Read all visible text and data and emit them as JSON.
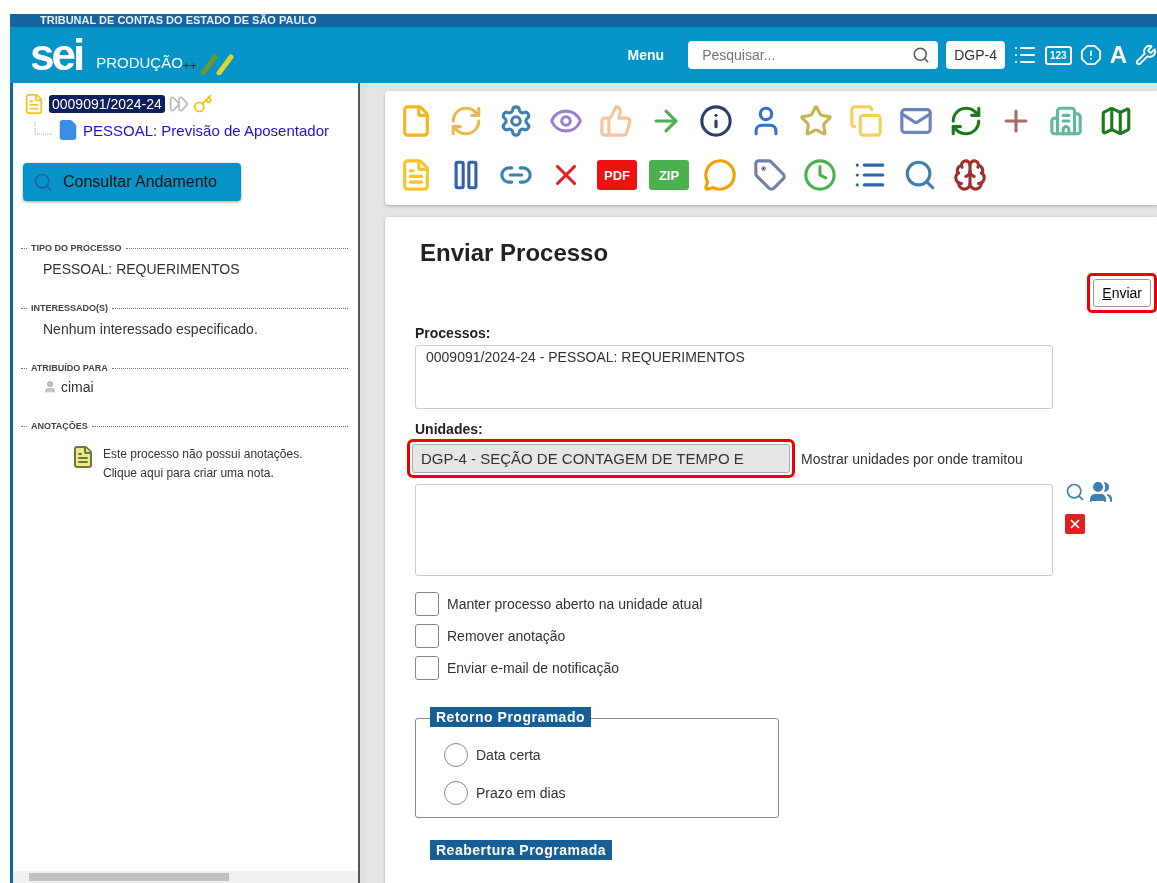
{
  "header": {
    "org": "TRIBUNAL DE CONTAS DO ESTADO DE SÃO PAULO",
    "logo": "sei",
    "env": "PRODUÇÃO",
    "env_suffix": "++",
    "menu": "Menu",
    "search": {
      "placeholder": "Pesquisar..."
    },
    "unit": "DGP-4",
    "icon_texts": [
      "123",
      "A"
    ]
  },
  "sidebar": {
    "process": {
      "number": "0009091/2024-24",
      "selected": true,
      "children": [
        {
          "label": "PESSOAL: Previsão de Aposentador",
          "selected": false
        }
      ]
    },
    "consult_button": "Consultar Andamento",
    "sections": [
      {
        "title": "TIPO DO PROCESSO",
        "kind": "text",
        "value": "PESSOAL: REQUERIMENTOS"
      },
      {
        "title": "INTERESSADO(S)",
        "kind": "text",
        "value": "Nenhum interessado especificado."
      },
      {
        "title": "ATRIBUÍDO PARA",
        "kind": "user",
        "value": "cimai"
      },
      {
        "title": "ANOTAÇÕES",
        "kind": "note",
        "value": "Este processo não possui anotações. Clique aqui para criar uma nota."
      }
    ]
  },
  "toolbar": {
    "rows": [
      [
        {
          "kind": "icon"
        },
        {
          "kind": "icon"
        },
        {
          "kind": "icon"
        },
        {
          "kind": "icon"
        },
        {
          "kind": "icon"
        },
        {
          "kind": "icon"
        },
        {
          "kind": "icon"
        },
        {
          "kind": "icon"
        },
        {
          "kind": "icon"
        },
        {
          "kind": "icon"
        },
        {
          "kind": "icon"
        },
        {
          "kind": "icon"
        },
        {
          "kind": "icon"
        },
        {
          "kind": "icon"
        },
        {
          "kind": "icon"
        }
      ],
      [
        {
          "kind": "icon"
        },
        {
          "kind": "icon"
        },
        {
          "kind": "icon"
        },
        {
          "kind": "icon"
        },
        {
          "kind": "badge",
          "text": "PDF",
          "color": "#ee1111"
        },
        {
          "kind": "badge",
          "text": "ZIP",
          "color": "#4caf50"
        },
        {
          "kind": "icon"
        },
        {
          "kind": "icon"
        },
        {
          "kind": "icon"
        },
        {
          "kind": "icon"
        },
        {
          "kind": "icon"
        },
        {
          "kind": "icon"
        }
      ]
    ]
  },
  "form": {
    "title": "Enviar Processo",
    "submit": {
      "label": "Enviar",
      "highlighted": true
    },
    "processes": {
      "label": "Processos:",
      "value": "0009091/2024-24 - PESSOAL: REQUERIMENTOS"
    },
    "units": {
      "label": "Unidades:",
      "value": "DGP-4 - SEÇÃO DE CONTAGEM DE TEMPO E",
      "highlighted": true,
      "show_all": "Mostrar unidades por onde tramitou"
    },
    "options": [
      {
        "label": "Manter processo aberto na unidade atual",
        "checked": false
      },
      {
        "label": "Remover anotação",
        "checked": false
      },
      {
        "label": "Enviar e-mail de notificação",
        "checked": false
      }
    ],
    "return": {
      "legend": "Retorno Programado",
      "options": [
        {
          "label": "Data certa",
          "selected": false
        },
        {
          "label": "Prazo em dias",
          "selected": false
        }
      ]
    },
    "reopen": {
      "legend": "Reabertura Programada"
    }
  }
}
